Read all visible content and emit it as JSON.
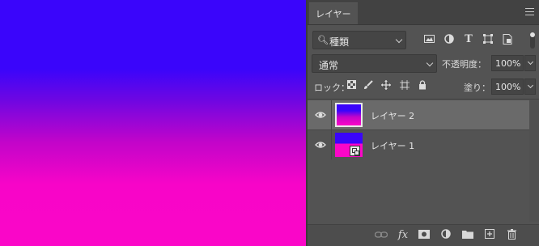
{
  "panel": {
    "tab_label": "レイヤー",
    "filter": {
      "label": "種類",
      "icons": [
        "image-filter-icon",
        "adjustment-filter-icon",
        "type-filter-icon",
        "shape-filter-icon",
        "smart-object-filter-icon"
      ]
    },
    "blend": {
      "mode": "通常",
      "opacity_label": "不透明度：",
      "opacity_value": "100%"
    },
    "lock": {
      "label": "ロック：",
      "fill_label": "塗り：",
      "fill_value": "100%"
    },
    "layers": [
      {
        "name": "レイヤー 2",
        "visible": true,
        "selected": true
      },
      {
        "name": "レイヤー 1",
        "visible": true,
        "selected": false,
        "smart_object": true
      }
    ]
  },
  "colors": {
    "canvas_top": "#3a05fb",
    "canvas_bottom": "#fb06c8",
    "panel_bg": "#535353",
    "selected_row": "#6a6a6a"
  }
}
